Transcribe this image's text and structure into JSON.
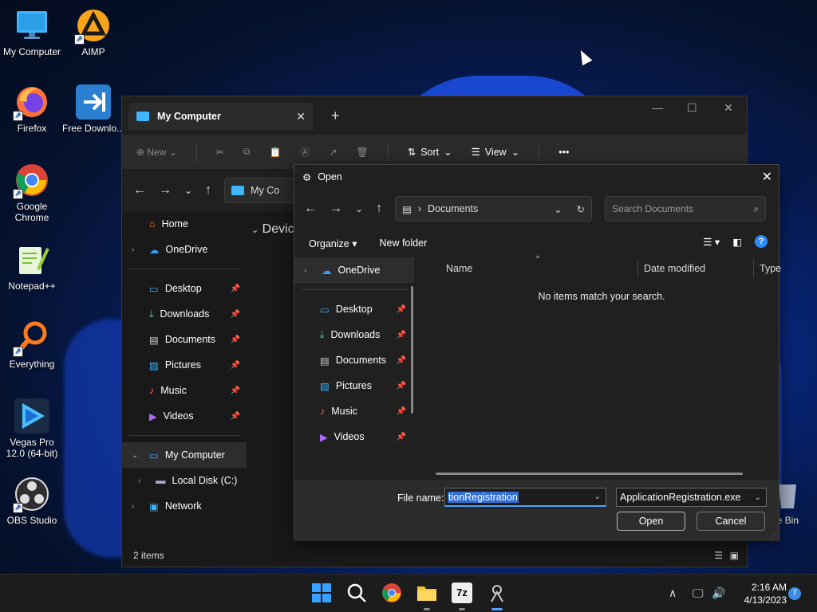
{
  "desktop": {
    "icons": [
      {
        "label": "My Computer",
        "icon": "monitor-icon"
      },
      {
        "label": "AIMP",
        "icon": "aimp-icon"
      },
      {
        "label": "Firefox",
        "icon": "firefox-icon"
      },
      {
        "label": "Free Downlo...",
        "icon": "download-manager-icon"
      },
      {
        "label": "Google Chrome",
        "icon": "chrome-icon"
      },
      {
        "label": "Notepad++",
        "icon": "notepadpp-icon"
      },
      {
        "label": "Everything",
        "icon": "search-tool-icon"
      },
      {
        "label": "Vegas Pro 12.0 (64-bit)",
        "icon": "vegas-icon"
      },
      {
        "label": "OBS Studio",
        "icon": "obs-icon"
      },
      {
        "label": "le Bin",
        "icon": "recycle-bin-icon"
      }
    ]
  },
  "explorer": {
    "tab_title": "My Computer",
    "toolbar": {
      "new_label": "New",
      "sort_label": "Sort",
      "view_label": "View",
      "more": "•••"
    },
    "address": "My Co",
    "nav": [
      {
        "label": "Home"
      },
      {
        "label": "OneDrive"
      },
      {
        "label": "Desktop"
      },
      {
        "label": "Downloads"
      },
      {
        "label": "Documents"
      },
      {
        "label": "Pictures"
      },
      {
        "label": "Music"
      },
      {
        "label": "Videos"
      },
      {
        "label": "My Computer"
      },
      {
        "label": "Local Disk (C:)"
      },
      {
        "label": "Network"
      }
    ],
    "main_heading": "Devic",
    "status": "2 items"
  },
  "dialog": {
    "title": "Open",
    "address_folder": "Documents",
    "search_placeholder": "Search Documents",
    "organize_label": "Organize",
    "new_folder_label": "New folder",
    "help": "?",
    "nav": [
      {
        "label": "OneDrive"
      },
      {
        "label": "Desktop"
      },
      {
        "label": "Downloads"
      },
      {
        "label": "Documents"
      },
      {
        "label": "Pictures"
      },
      {
        "label": "Music"
      },
      {
        "label": "Videos"
      }
    ],
    "columns": {
      "name": "Name",
      "date_modified": "Date modified",
      "type": "Type"
    },
    "empty_message": "No items match your search.",
    "file_name_label": "File name:",
    "file_name_value": "tionRegistration",
    "file_type_value": "ApplicationRegistration.exe",
    "open_label": "Open",
    "cancel_label": "Cancel"
  },
  "taskbar": {
    "time": "2:16 AM",
    "date": "4/13/2023",
    "notification_count": "7"
  }
}
